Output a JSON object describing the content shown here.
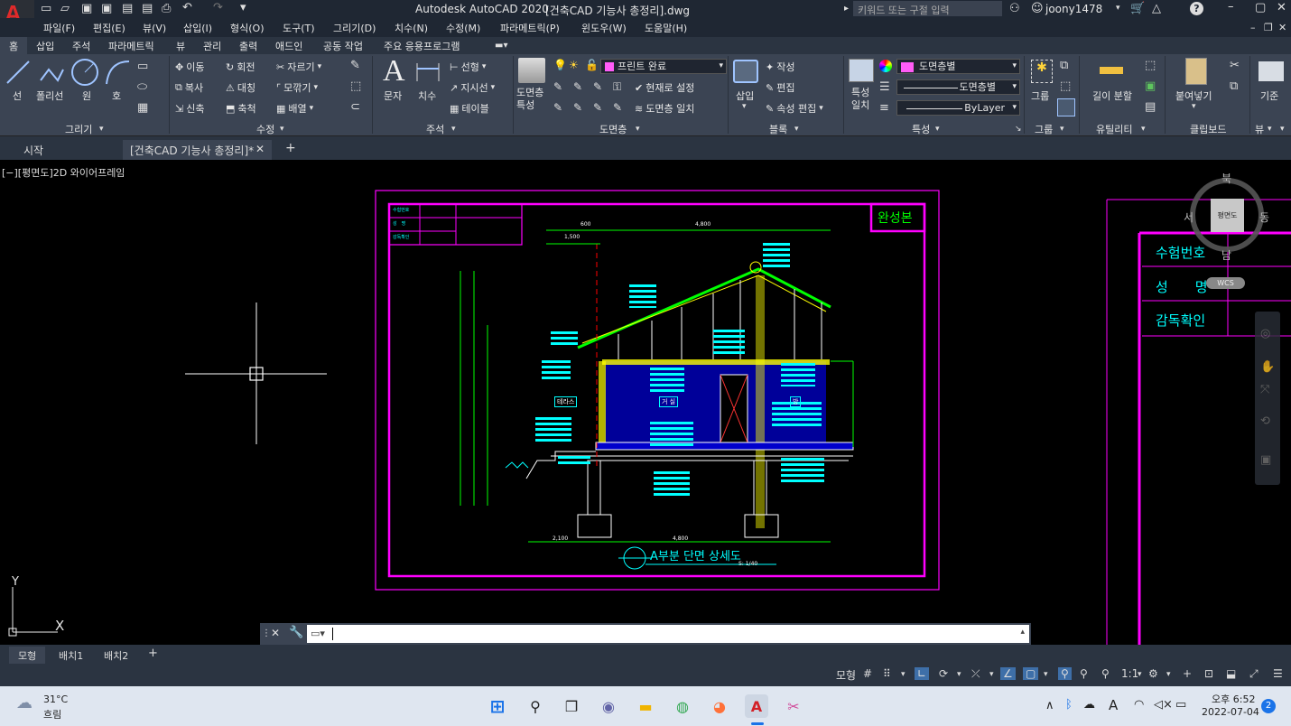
{
  "app": {
    "title": "Autodesk AutoCAD 2020",
    "filename": "[건축CAD 기능사 총정리].dwg",
    "logo_letter": "A",
    "search_placeholder": "키워드 또는 구절 입력",
    "user": "joony1478"
  },
  "menu": [
    "파일(F)",
    "편집(E)",
    "뷰(V)",
    "삽입(I)",
    "형식(O)",
    "도구(T)",
    "그리기(D)",
    "치수(N)",
    "수정(M)",
    "파라메트릭(P)",
    "윈도우(W)",
    "도움말(H)"
  ],
  "ribbon_tabs": [
    "홈",
    "삽입",
    "주석",
    "파라메트릭",
    "뷰",
    "관리",
    "출력",
    "애드인",
    "공동 작업",
    "주요 응용프로그램"
  ],
  "ribbon": {
    "draw": {
      "title": "그리기",
      "line": "선",
      "polyline": "폴리선",
      "circle": "원",
      "arc": "호"
    },
    "modify": {
      "title": "수정",
      "move": "이동",
      "rotate": "회전",
      "trim": "자르기",
      "copy": "복사",
      "mirror": "대칭",
      "fillet": "모깎기",
      "stretch": "신축",
      "scale": "축척",
      "array": "배열"
    },
    "annotation": {
      "title": "주석",
      "text": "문자",
      "dimension": "치수",
      "linear": "선형",
      "leader": "지시선",
      "table": "테이블"
    },
    "layers": {
      "title": "도면층",
      "properties": "도면층\n특성",
      "current_layer": "프린트 완료",
      "make_current": "현재로 설정",
      "match_layer": "도면층 일치"
    },
    "block": {
      "title": "블록",
      "insert": "삽입",
      "create": "작성",
      "edit": "편집",
      "edit_attr": "속성 편집"
    },
    "properties": {
      "title": "특성",
      "match": "특성\n일치",
      "color": "도면층별",
      "linetype": "도면층별",
      "lineweight": "ByLayer"
    },
    "groups": {
      "title": "그룹",
      "group": "그룹"
    },
    "utilities": {
      "title": "유틸리티",
      "measure": "길이 분할"
    },
    "clipboard": {
      "title": "클립보드",
      "paste": "붙여넣기"
    },
    "view": {
      "title": "뷰",
      "base": "기준"
    }
  },
  "doc_tabs": [
    "시작",
    "[건축CAD 기능사 총정리]*"
  ],
  "viewport_label": "[−][평면도]2D 와이어프레임",
  "viewcube": {
    "north": "북",
    "south": "남",
    "east": "동",
    "west": "서",
    "face": "평면도",
    "wcs": "WCS"
  },
  "drawing": {
    "stamp": "완성본",
    "title": "A부분 단면 상세도",
    "scale": "S: 1/40",
    "side_table": [
      "수험번호",
      "성　　명",
      "감독확인"
    ],
    "small_table": [
      "수험번호",
      "성　명",
      "감독확인"
    ],
    "dims_top": [
      "600",
      "4,800",
      "",
      "1,500"
    ],
    "dims_bottom": [
      "2,100",
      "4,800"
    ],
    "room_labels": [
      "테라스",
      "거 실",
      "방"
    ]
  },
  "ucs": {
    "x": "X",
    "y": "Y"
  },
  "layout_tabs": [
    "모형",
    "배치1",
    "배치2"
  ],
  "status": {
    "model": "모형",
    "scale": "1:1"
  },
  "taskbar": {
    "temp": "31°C",
    "weather": "흐림",
    "time": "오후 6:52",
    "date": "2022-07-04",
    "notif": "2"
  },
  "colors": {
    "magenta": "#ff00ff",
    "cyan": "#00ffff",
    "green": "#00ff00",
    "yellow": "#ffff00",
    "blue": "#0000ff",
    "accent": "#d31f26"
  }
}
